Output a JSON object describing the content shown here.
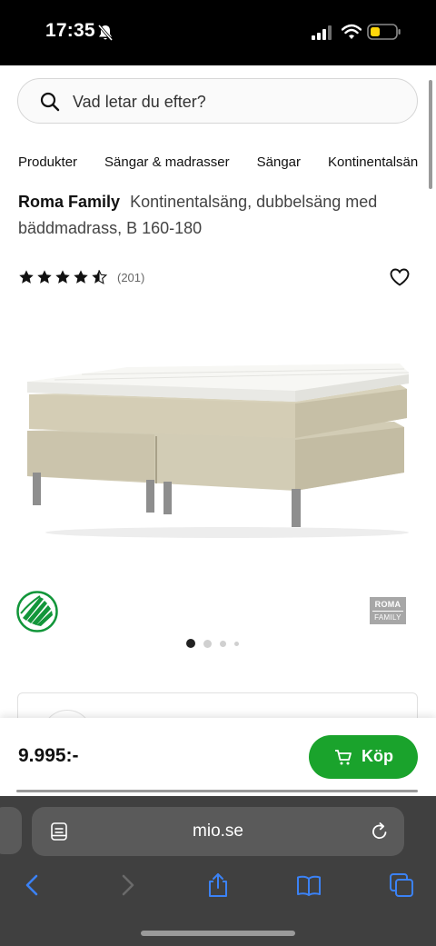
{
  "status_bar": {
    "time": "17:35",
    "icons": [
      "bell-slash-icon",
      "cellular-signal-icon",
      "wifi-icon",
      "battery-icon"
    ]
  },
  "search": {
    "placeholder": "Vad letar du efter?"
  },
  "breadcrumb": [
    "Produkter",
    "Sängar & madrasser",
    "Sängar",
    "Kontinentalsängar"
  ],
  "product": {
    "brand": "Roma Family",
    "title": "Kontinentalsäng, dubbelsäng med bäddmadrass, B 160-180",
    "rating": 4.5,
    "review_count": "(201)",
    "price": "9.995:-",
    "buy_label": "Köp",
    "brand_logo_line1": "ROMA",
    "brand_logo_line2": "FAMILY"
  },
  "carousel": {
    "count": 4,
    "active_index": 0
  },
  "browser": {
    "url": "mio.se"
  },
  "colors": {
    "accent_green": "#1aa32c",
    "status_bar": "#000000",
    "browser_chrome": "#404040",
    "browser_icon_blue": "#3b82f6",
    "bed_fabric": "#d2ccb5",
    "swan_green": "#12963a",
    "battery_yellow": "#ffd60a"
  }
}
